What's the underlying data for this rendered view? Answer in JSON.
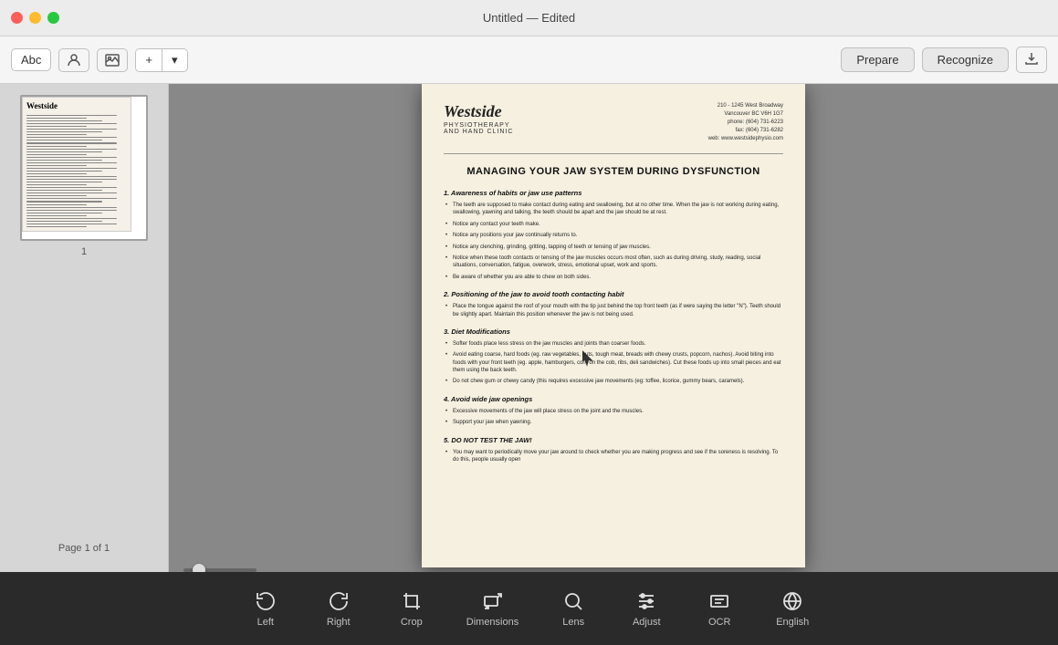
{
  "titlebar": {
    "title": "Untitled — Edited",
    "buttons": {
      "close": "●",
      "minimize": "●",
      "maximize": "●"
    }
  },
  "toolbar": {
    "abc_label": "Abc",
    "person_icon": "person",
    "image_icon": "image",
    "add_label": "+",
    "prepare_label": "Prepare",
    "recognize_label": "Recognize",
    "export_icon": "export"
  },
  "sidebar": {
    "page_number": "1",
    "page_info": "Page 1 of 1"
  },
  "document": {
    "logo": "Westside",
    "logo_sub": "PHYSIOTHERAPY\nAND HAND CLINIC",
    "address_lines": [
      "210 - 1245 West Broadway",
      "Vancouver BC V6H 1G7",
      "phone: (604) 731-6223",
      "fax: (604) 731-6282",
      "web: www.westsidephysio.com"
    ],
    "title": "MANAGING YOUR JAW SYSTEM DURING DYSFUNCTION",
    "sections": [
      {
        "heading": "1. Awareness of habits or jaw use patterns",
        "bullets": [
          "The teeth are supposed to make contact during eating and swallowing, but at no other time. When the jaw is not working during eating, swallowing, yawning and talking, the teeth should be apart and the jaw should be at rest.",
          "Notice any contact your teeth make.",
          "Notice any positions your jaw continually returns to.",
          "Notice any clenching, grinding, gritting, tapping of teeth or tensing of jaw muscles.",
          "Notice when these tooth contacts or tensing of the jaw muscles occurs most often, such as during driving, study, reading, social situations, conversation, fatigue, overwork, stress, emotional upset, work and sports.",
          "Be aware of whether you are able to chew on both sides."
        ]
      },
      {
        "heading": "2. Positioning of the jaw to avoid tooth contacting habit",
        "bullets": [
          "Place the tongue against the roof of your mouth with the tip just behind the top front teeth (as if were saying the letter \"N\"). Teeth should be slightly apart. Maintain this position whenever the jaw is not being used."
        ]
      },
      {
        "heading": "3. Diet Modifications",
        "bullets": [
          "Softer foods place less stress on the jaw muscles and joints than coarser foods.",
          "Avoid eating coarse, hard foods (eg. raw vegetables, nuts, tough meat, breads with chewy crusts, popcorn, nachos). Avoid biting into foods with your front teeth (eg. apple, hamburgers, corn on the cob, ribs, deli sandwiches). Cut these foods up into small pieces and eat them using the back teeth.",
          "Do not chew gum or chewy candy (this requires excessive jaw movements (eg: toffee, licorice, gummy bears, caramels)."
        ]
      },
      {
        "heading": "4. Avoid wide jaw openings",
        "bullets": [
          "Excessive movements of the jaw will place stress on the joint and the muscles.",
          "Support your jaw when yawning."
        ]
      },
      {
        "heading": "5. DO NOT TEST THE JAW!",
        "bullets": [
          "You may want to periodically move your jaw around to check whether you are making progress and see if the soreness is resolving. To do this, people usually open"
        ]
      }
    ]
  },
  "bottom_toolbar": {
    "tools": [
      {
        "id": "left",
        "label": "Left",
        "icon": "rotate-left"
      },
      {
        "id": "right",
        "label": "Right",
        "icon": "rotate-right"
      },
      {
        "id": "crop",
        "label": "Crop",
        "icon": "crop"
      },
      {
        "id": "dimensions",
        "label": "Dimensions",
        "icon": "dimensions"
      },
      {
        "id": "lens",
        "label": "Lens",
        "icon": "lens"
      },
      {
        "id": "adjust",
        "label": "Adjust",
        "icon": "adjust"
      },
      {
        "id": "ocr",
        "label": "OCR",
        "icon": "ocr"
      },
      {
        "id": "english",
        "label": "English",
        "icon": "english"
      }
    ]
  },
  "zoom": {
    "position": 15
  }
}
